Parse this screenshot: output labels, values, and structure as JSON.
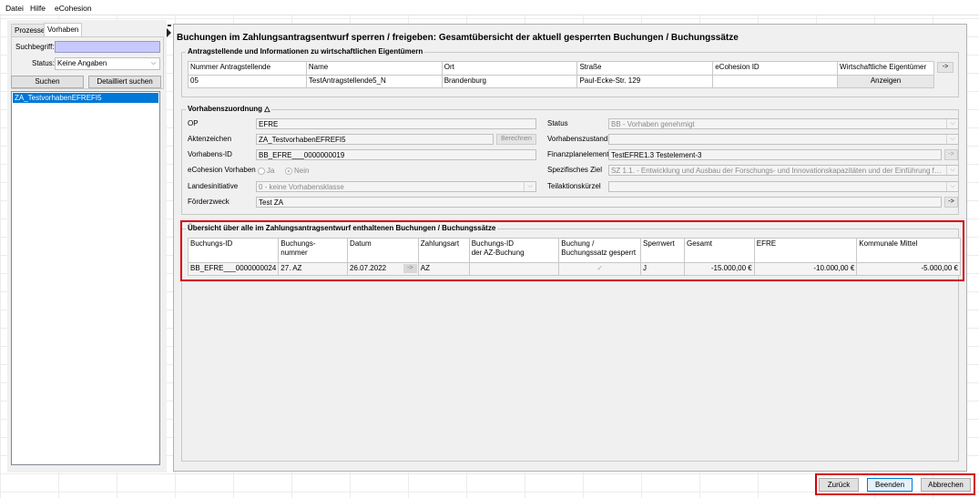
{
  "menu": {
    "datei": "Datei",
    "hilfe": "Hilfe",
    "ecohesion": "eCohesion"
  },
  "left": {
    "tab_prozesse": "Prozesse",
    "tab_vorhaben": "Vorhaben",
    "suchbegriff_label": "Suchbegriff:",
    "suchbegriff_value": "",
    "status_label": "Status:",
    "status_value": "Keine Angaben",
    "suchen": "Suchen",
    "detailliert": "Detailliert suchen",
    "items": [
      "ZA_TestvorhabenEFREFI5"
    ]
  },
  "main": {
    "title": "Buchungen im Zahlungsantragsentwurf sperren / freigeben: Gesamtübersicht der aktuell gesperrten Buchungen / Buchungssätze",
    "antrag": {
      "title": "Antragstellende und Informationen zu wirtschaftlichen Eigentümern",
      "headers": [
        "Nummer Antragstellende",
        "Name",
        "Ort",
        "Straße",
        "eCohesion ID",
        "Wirtschaftliche Eigentümer"
      ],
      "row": [
        "05",
        "TestAntragstellende5_N",
        "Brandenburg",
        "Paul-Ecke-Str. 129",
        "",
        "Anzeigen"
      ],
      "arrow": "->"
    },
    "vorhaben": {
      "title": "Vorhabenszuordnung △",
      "op_label": "OP",
      "op": "EFRE",
      "akten_label": "Aktenzeichen",
      "akten": "ZA_TestvorhabenEFREFI5",
      "berechnen": "Berechnen",
      "vid_label": "Vorhabens-ID",
      "vid": "BB_EFRE___0000000019",
      "ecv_label": "eCohesion Vorhaben",
      "ja": "Ja",
      "nein": "Nein",
      "landes_label": "Landesinitiative",
      "landes": "0 - keine Vorhabensklasse",
      "foerder_label": "Förderzweck",
      "foerder": "Test ZA",
      "status_label": "Status",
      "status": "BB - Vorhaben genehmigt",
      "zustand_label": "Vorhabenszustand",
      "zustand": "",
      "finanz_label": "Finanzplanelement",
      "finanz": "TestEFRE1.3 Testelement-3",
      "ziel_label": "Spezifisches Ziel",
      "ziel": "SZ 1.1. - Entwicklung und Ausbau der Forschungs- und Innovationskapazitäten und der Einführung fortsch...",
      "teil_label": "Teilaktionskürzel",
      "teil": "",
      "arrow": "->"
    },
    "buchungen": {
      "title": "Übersicht über alle im Zahlungsantragsentwurf enthaltenen Buchungen / Buchungssätze",
      "headers": [
        "Buchungs-ID",
        "Buchungs-\nnummer",
        "Datum",
        "Zahlungsart",
        "Buchungs-ID\nder AZ-Buchung",
        "Buchung /\nBuchungssatz gesperrt",
        "Sperrwert",
        "Gesamt",
        "EFRE",
        "Kommunale Mittel"
      ],
      "row": [
        "BB_EFRE___0000000024",
        "27. AZ",
        "26.07.2022",
        "AZ",
        "",
        "✓",
        "J",
        "-15.000,00 €",
        "-10.000,00 €",
        "-5.000,00 €"
      ],
      "arrow": "->"
    }
  },
  "footer": {
    "zurueck": "Zurück",
    "beenden": "Beenden",
    "abbrechen": "Abbrechen"
  }
}
